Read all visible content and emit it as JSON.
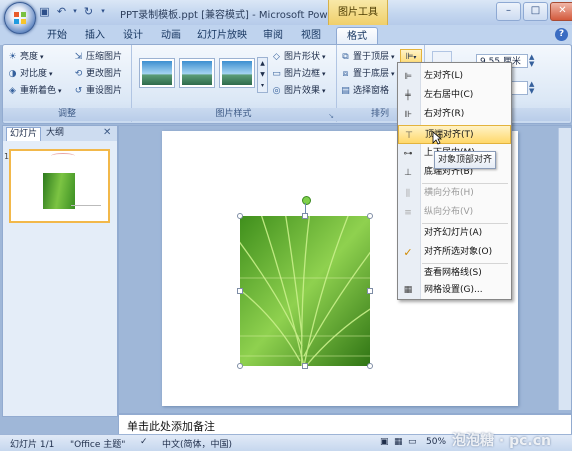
{
  "window": {
    "title": "PPT录制模板.ppt [兼容模式] - Microsoft PowerP...",
    "context_tab_group": "图片工具"
  },
  "tabs": [
    {
      "label": "开始"
    },
    {
      "label": "插入"
    },
    {
      "label": "设计"
    },
    {
      "label": "动画"
    },
    {
      "label": "幻灯片放映"
    },
    {
      "label": "审阅"
    },
    {
      "label": "视图"
    },
    {
      "label": "格式",
      "active": true
    }
  ],
  "ribbon": {
    "adjust": {
      "label": "调整",
      "brightness": "亮度",
      "contrast": "对比度",
      "recolor": "重新着色",
      "compress": "压缩图片",
      "change_picture": "更改图片",
      "reset_picture": "重设图片"
    },
    "picture_styles": {
      "label": "图片样式",
      "shape": "图片形状",
      "border": "图片边框",
      "effects": "图片效果"
    },
    "arrange": {
      "label": "排列",
      "bring_front": "置于顶层",
      "send_back": "置于底层",
      "selection_pane": "选择窗格"
    },
    "size": {
      "width_value": "9.55 厘米"
    }
  },
  "left_pane": {
    "tab_slides": "幻灯片",
    "tab_outline": "大纲",
    "slide_number": "1"
  },
  "notes": {
    "placeholder": "单击此处添加备注"
  },
  "status": {
    "slide": "幻灯片 1/1",
    "theme": "\"Office 主题\"",
    "language": "中文(简体，中国)",
    "zoom": "50%"
  },
  "align_menu": {
    "items": [
      {
        "label": "左对齐(L)",
        "icon": "align-left-icon"
      },
      {
        "label": "左右居中(C)",
        "icon": "align-center-icon"
      },
      {
        "label": "右对齐(R)",
        "icon": "align-right-icon"
      },
      {
        "label": "顶端对齐(T)",
        "icon": "align-top-icon",
        "highlighted": true
      },
      {
        "label": "上下居中(M)",
        "icon": "align-middle-icon"
      },
      {
        "label": "底端对齐(B)",
        "icon": "align-bottom-icon"
      },
      {
        "label": "横向分布(H)",
        "icon": "distribute-horizontal-icon",
        "disabled": true
      },
      {
        "label": "纵向分布(V)",
        "icon": "distribute-vertical-icon",
        "disabled": true
      },
      {
        "label": "对齐幻灯片(A)"
      },
      {
        "label": "对齐所选对象(O)",
        "checked": true
      },
      {
        "label": "查看网格线(S)"
      },
      {
        "label": "网格设置(G)...",
        "icon": "grid-settings-icon"
      }
    ],
    "tooltip": "对象顶部对齐"
  },
  "watermark": "泡泡糖 · pc.cn",
  "colors": {
    "ribbon_bg": "#dce8f6",
    "context_tab": "#f0cf6b",
    "menu_highlight": "#ffd86b",
    "slide_thumb_border": "#f2b84a"
  }
}
